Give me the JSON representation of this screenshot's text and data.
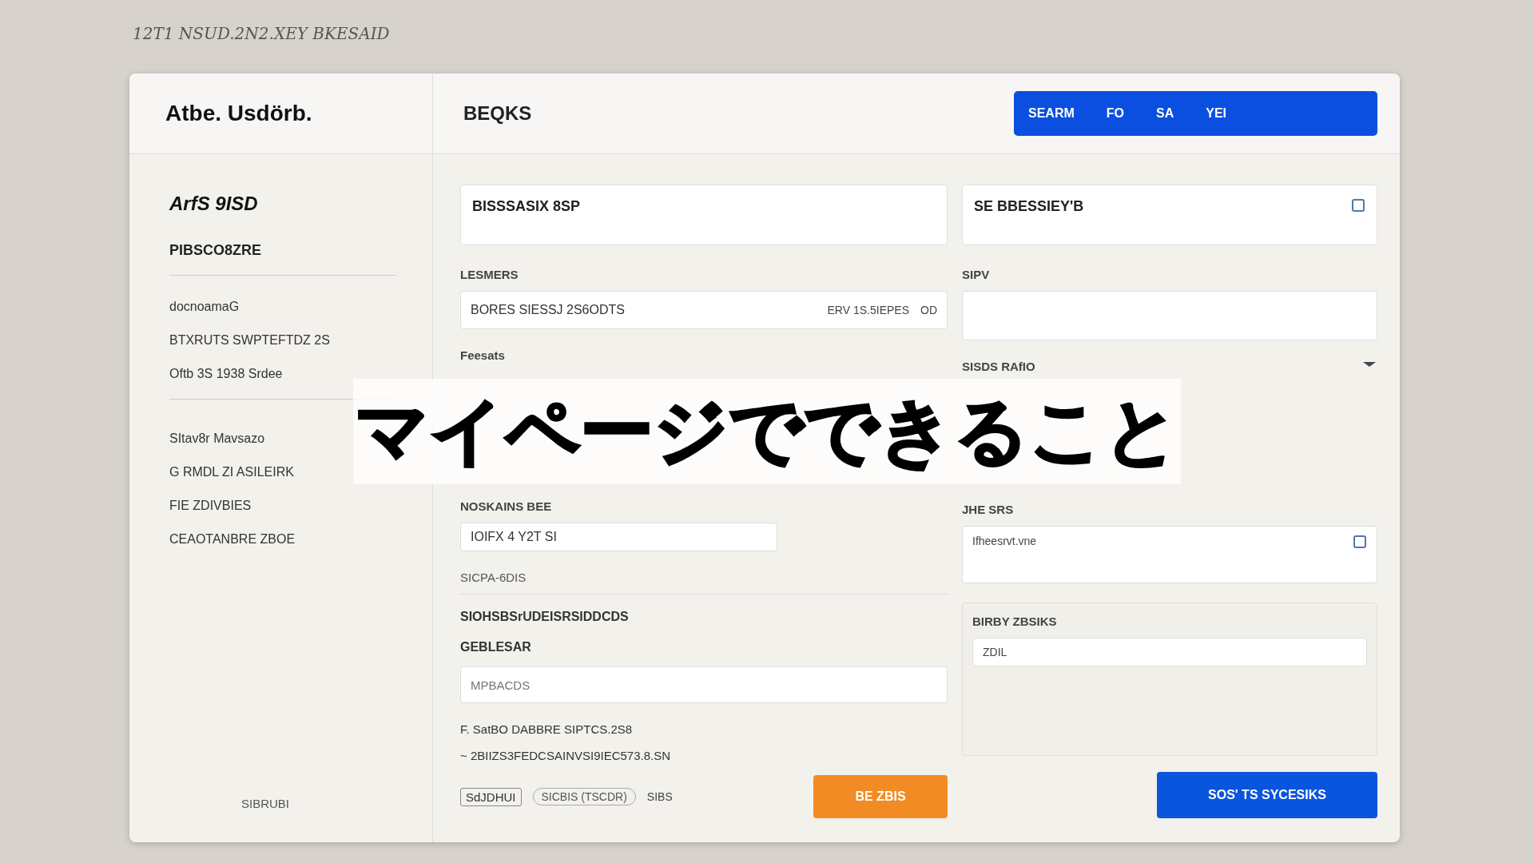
{
  "caption": "12T1 NSUD.2N2.XEY BKESAID",
  "app_title": "Atbe. Usdörb.",
  "page_title": "BEQKS",
  "header_button": {
    "label": "SEARM",
    "parts": [
      "FO",
      "SA",
      "YEI"
    ]
  },
  "sidebar": {
    "heading": "ArfS 9ISD",
    "subheading": "PIBSCO8ZRE",
    "groups": [
      [
        "docnoamaG",
        "BTXRUTS SWPTEFTDZ 2S",
        "Oftb 3S 1938 Srdee"
      ],
      [
        "SItav8r Mavsazo",
        "G RMDL ZI ASILEIRK",
        "FIE ZDIVBIES",
        "CEAOTANBRE ZBOE"
      ]
    ],
    "footer": "SIBRUBI"
  },
  "left": {
    "card_title": "BISSSASIX 8SP",
    "label_1": "LESMERS",
    "field_1": {
      "value": "BORES SIESSJ 2S6ODTS",
      "note": "ERV 1S.5IEPES",
      "suffix": "OD"
    },
    "label_2": "Feesats",
    "label_3": "NOSKAINS BEE",
    "field_3": {
      "value": "IOIFX 4 Y2T SI"
    },
    "note": "SICPA-6DIS",
    "paragraph": [
      "SIOHSBSrUDEISRSIDDCDS",
      "GEBLESAR"
    ],
    "field_4": {
      "placeholder": "MPBACDS"
    },
    "lines": [
      "F. SatBO DABBRE SIPTCS.2S8",
      "~ 2BIIZS3FEDCSAINVSI9IEC573.8.SN"
    ],
    "footer": {
      "tag": "SdJDHUI",
      "pill": "SICBIS (TSCDR)",
      "text": "SIBS"
    },
    "button": "BE ZBIS"
  },
  "right": {
    "card_title": "SE BBESSIEY'B",
    "label_1": "SIPV",
    "label_2": "SISDS RAfIO",
    "label_3": "JHE SRS",
    "textarea": {
      "value": "Ifheesrvt.vne"
    },
    "label_4": "BIRBY ZBSIKS",
    "field_4": {
      "value": "ZDIL"
    },
    "button": "SOS' TS SYCESIKS"
  },
  "banner": "マイページでできること"
}
